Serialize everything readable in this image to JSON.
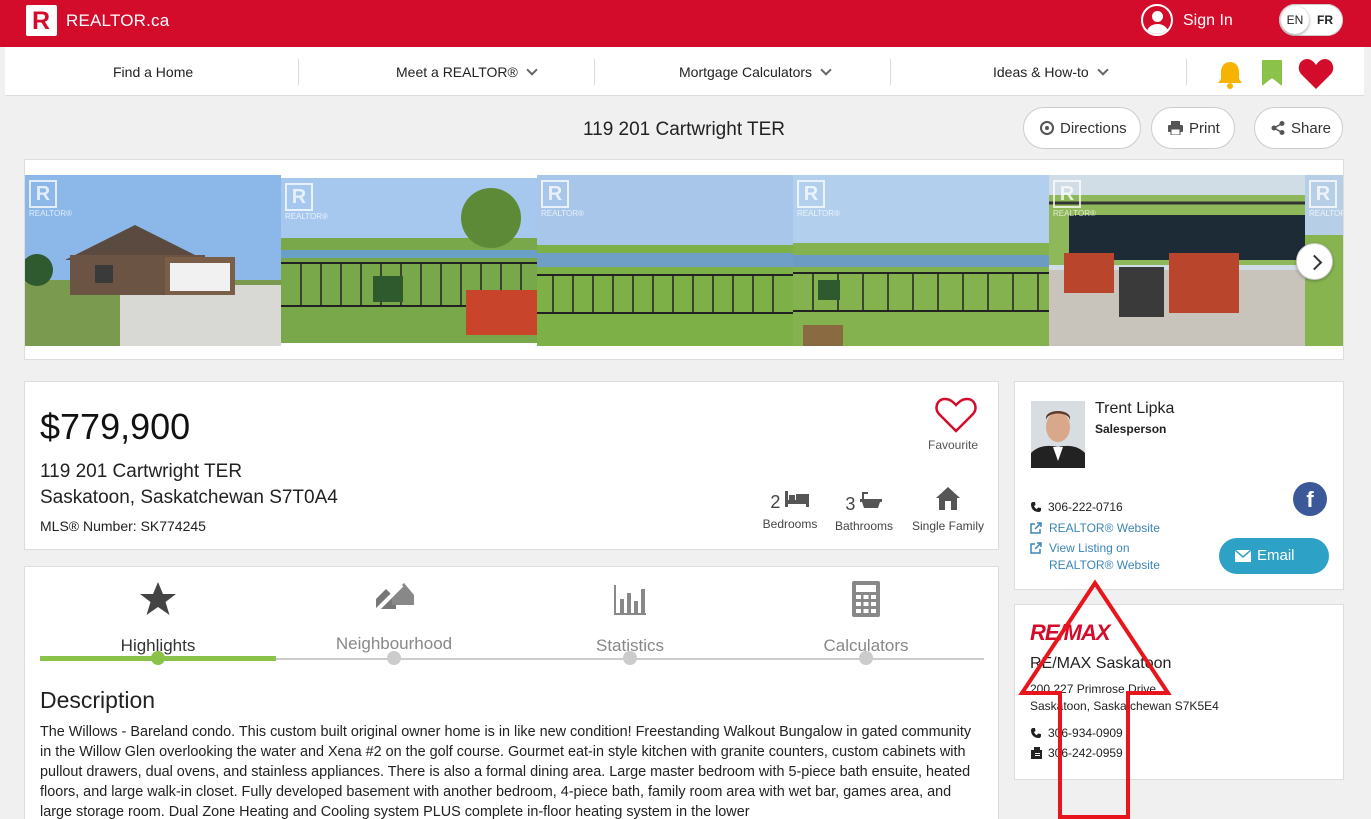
{
  "header": {
    "logo_letter": "R",
    "logo_text": "REALTOR.ca",
    "signin_label": "Sign In",
    "lang_en": "EN",
    "lang_fr": "FR"
  },
  "nav": {
    "items": [
      {
        "label": "Find a Home"
      },
      {
        "label": "Meet a REALTOR®"
      },
      {
        "label": "Mortgage Calculators"
      },
      {
        "label": "Ideas & How-to"
      }
    ]
  },
  "listing": {
    "title": "119 201 Cartwright TER",
    "actions": {
      "directions": "Directions",
      "print": "Print",
      "share": "Share"
    },
    "price": "$779,900",
    "address_line1": "119 201 Cartwright TER",
    "address_line2": "Saskatoon, Saskatchewan S7T0A4",
    "mls": "MLS® Number: SK774245",
    "favourite_label": "Favourite",
    "bedrooms_count": "2",
    "bedrooms_label": "Bedrooms",
    "bathrooms_count": "3",
    "bathrooms_label": "Bathrooms",
    "property_type": "Single Family",
    "photo_watermark": "REALTOR®"
  },
  "tabs": [
    {
      "label": "Highlights",
      "active": true
    },
    {
      "label": "Neighbourhood",
      "active": false
    },
    {
      "label": "Statistics",
      "active": false
    },
    {
      "label": "Calculators",
      "active": false
    }
  ],
  "description": {
    "title": "Description",
    "text": "The Willows - Bareland condo. This custom built original owner home is in like new condition! Freestanding Walkout Bungalow in gated community in the Willow Glen overlooking the water and Xena #2 on the golf course. Gourmet eat-in style kitchen with granite counters, custom cabinets with pullout drawers, dual ovens, and stainless appliances. There is also a formal dining area. Large master bedroom with 5-piece bath ensuite, heated floors, and large walk-in closet. Fully developed basement with another bedroom, 4-piece bath, family room area with wet bar, games area, and large storage room. Dual Zone Heating and Cooling system PLUS complete in-floor heating system in the lower"
  },
  "agent": {
    "name": "Trent Lipka",
    "role": "Salesperson",
    "phone": "306-222-0716",
    "website_link": "REALTOR® Website",
    "view_listing_line1": "View Listing on",
    "view_listing_line2": "REALTOR® Website",
    "email_label": "Email"
  },
  "office": {
    "logo_text": "RE/MAX",
    "name": "RE/MAX Saskatoon",
    "address_line1": "200 227 Primrose Drive",
    "address_line2": "Saskatoon, Saskatchewan S7K5E4",
    "phone": "306-934-0909",
    "fax": "306-242-0959"
  },
  "colors": {
    "brand_red": "#d40c2c",
    "accent_green": "#8bc34a",
    "link_blue": "#3a85b5",
    "email_button": "#2da1c6",
    "annotation_arrow": "#e8161c"
  }
}
